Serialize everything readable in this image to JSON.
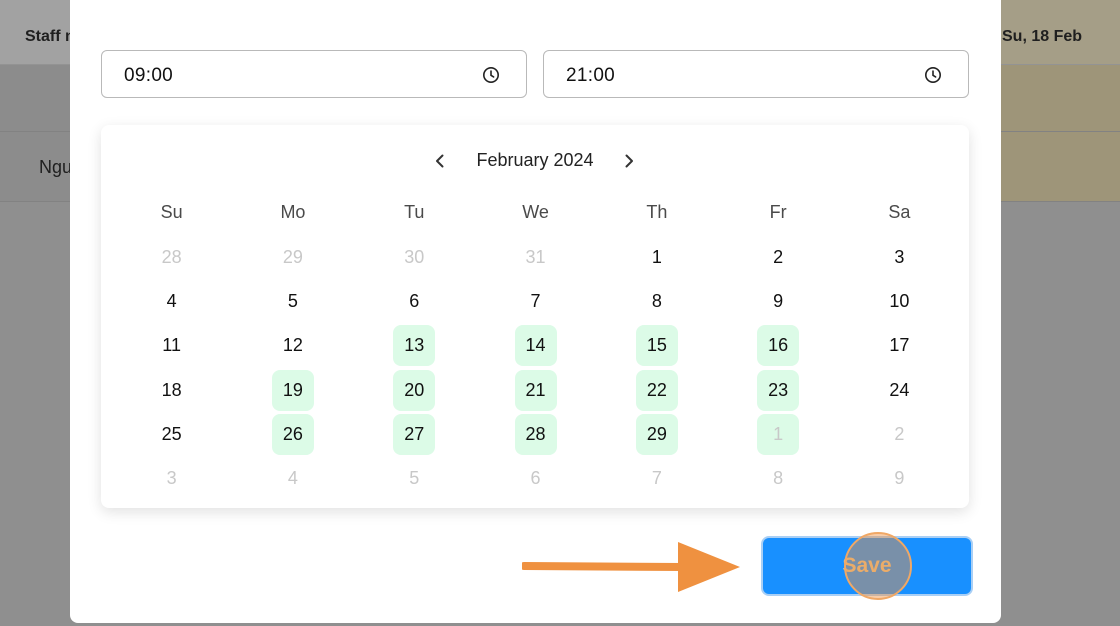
{
  "background": {
    "staff_header": "Staff n",
    "date_header": "Su, 18 Feb",
    "staff_name": "Ngu"
  },
  "time_range": {
    "start": "09:00",
    "end": "21:00"
  },
  "calendar": {
    "month_label": "February 2024",
    "weekdays": [
      "Su",
      "Mo",
      "Tu",
      "We",
      "Th",
      "Fr",
      "Sa"
    ],
    "days": [
      {
        "label": "28",
        "out": true,
        "hl": false
      },
      {
        "label": "29",
        "out": true,
        "hl": false
      },
      {
        "label": "30",
        "out": true,
        "hl": false
      },
      {
        "label": "31",
        "out": true,
        "hl": false
      },
      {
        "label": "1",
        "out": false,
        "hl": false
      },
      {
        "label": "2",
        "out": false,
        "hl": false
      },
      {
        "label": "3",
        "out": false,
        "hl": false
      },
      {
        "label": "4",
        "out": false,
        "hl": false
      },
      {
        "label": "5",
        "out": false,
        "hl": false
      },
      {
        "label": "6",
        "out": false,
        "hl": false
      },
      {
        "label": "7",
        "out": false,
        "hl": false
      },
      {
        "label": "8",
        "out": false,
        "hl": false
      },
      {
        "label": "9",
        "out": false,
        "hl": false
      },
      {
        "label": "10",
        "out": false,
        "hl": false
      },
      {
        "label": "11",
        "out": false,
        "hl": false
      },
      {
        "label": "12",
        "out": false,
        "hl": false
      },
      {
        "label": "13",
        "out": false,
        "hl": true
      },
      {
        "label": "14",
        "out": false,
        "hl": true
      },
      {
        "label": "15",
        "out": false,
        "hl": true
      },
      {
        "label": "16",
        "out": false,
        "hl": true
      },
      {
        "label": "17",
        "out": false,
        "hl": false
      },
      {
        "label": "18",
        "out": false,
        "hl": false
      },
      {
        "label": "19",
        "out": false,
        "hl": true
      },
      {
        "label": "20",
        "out": false,
        "hl": true
      },
      {
        "label": "21",
        "out": false,
        "hl": true
      },
      {
        "label": "22",
        "out": false,
        "hl": true
      },
      {
        "label": "23",
        "out": false,
        "hl": true
      },
      {
        "label": "24",
        "out": false,
        "hl": false
      },
      {
        "label": "25",
        "out": false,
        "hl": false
      },
      {
        "label": "26",
        "out": false,
        "hl": true
      },
      {
        "label": "27",
        "out": false,
        "hl": true
      },
      {
        "label": "28",
        "out": false,
        "hl": true
      },
      {
        "label": "29",
        "out": false,
        "hl": true
      },
      {
        "label": "1",
        "out": true,
        "hl": true
      },
      {
        "label": "2",
        "out": true,
        "hl": false
      },
      {
        "label": "3",
        "out": true,
        "hl": false
      },
      {
        "label": "4",
        "out": true,
        "hl": false
      },
      {
        "label": "5",
        "out": true,
        "hl": false
      },
      {
        "label": "6",
        "out": true,
        "hl": false
      },
      {
        "label": "7",
        "out": true,
        "hl": false
      },
      {
        "label": "8",
        "out": true,
        "hl": false
      },
      {
        "label": "9",
        "out": true,
        "hl": false
      }
    ]
  },
  "actions": {
    "save_label": "Save"
  },
  "colors": {
    "highlight": "#dcfbe7",
    "primary": "#1890ff",
    "annotation": "#ef9140"
  }
}
